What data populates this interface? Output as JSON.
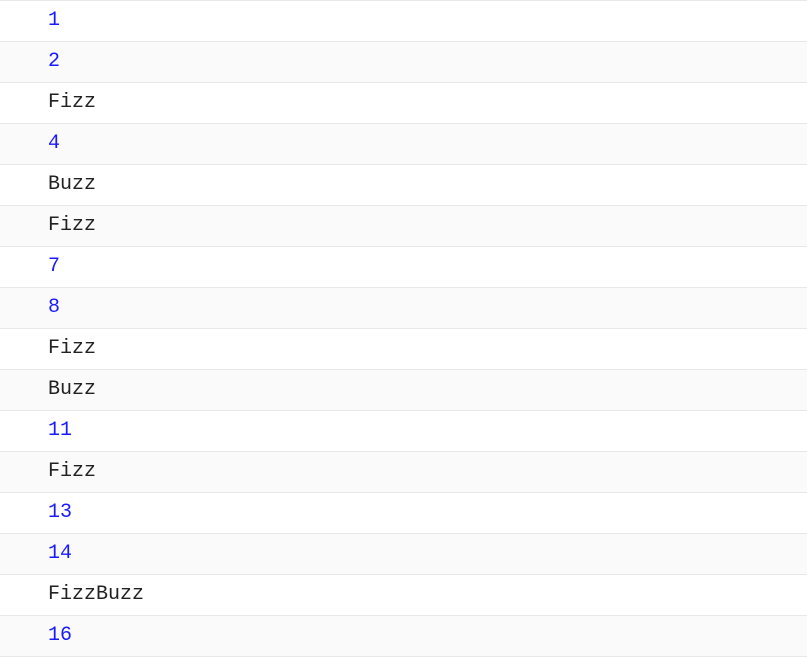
{
  "output": [
    {
      "value": "1",
      "type": "numeric"
    },
    {
      "value": "2",
      "type": "numeric"
    },
    {
      "value": "Fizz",
      "type": "text"
    },
    {
      "value": "4",
      "type": "numeric"
    },
    {
      "value": "Buzz",
      "type": "text"
    },
    {
      "value": "Fizz",
      "type": "text"
    },
    {
      "value": "7",
      "type": "numeric"
    },
    {
      "value": "8",
      "type": "numeric"
    },
    {
      "value": "Fizz",
      "type": "text"
    },
    {
      "value": "Buzz",
      "type": "text"
    },
    {
      "value": "11",
      "type": "numeric"
    },
    {
      "value": "Fizz",
      "type": "text"
    },
    {
      "value": "13",
      "type": "numeric"
    },
    {
      "value": "14",
      "type": "numeric"
    },
    {
      "value": "FizzBuzz",
      "type": "text"
    },
    {
      "value": "16",
      "type": "numeric"
    }
  ]
}
